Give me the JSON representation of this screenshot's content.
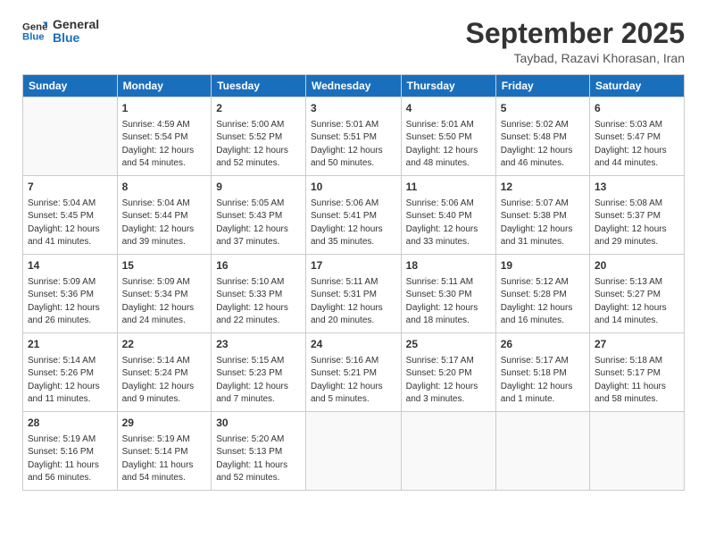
{
  "logo": {
    "line1": "General",
    "line2": "Blue"
  },
  "title": "September 2025",
  "location": "Taybad, Razavi Khorasan, Iran",
  "weekdays": [
    "Sunday",
    "Monday",
    "Tuesday",
    "Wednesday",
    "Thursday",
    "Friday",
    "Saturday"
  ],
  "weeks": [
    [
      {
        "day": "",
        "info": ""
      },
      {
        "day": "1",
        "info": "Sunrise: 4:59 AM\nSunset: 5:54 PM\nDaylight: 12 hours\nand 54 minutes."
      },
      {
        "day": "2",
        "info": "Sunrise: 5:00 AM\nSunset: 5:52 PM\nDaylight: 12 hours\nand 52 minutes."
      },
      {
        "day": "3",
        "info": "Sunrise: 5:01 AM\nSunset: 5:51 PM\nDaylight: 12 hours\nand 50 minutes."
      },
      {
        "day": "4",
        "info": "Sunrise: 5:01 AM\nSunset: 5:50 PM\nDaylight: 12 hours\nand 48 minutes."
      },
      {
        "day": "5",
        "info": "Sunrise: 5:02 AM\nSunset: 5:48 PM\nDaylight: 12 hours\nand 46 minutes."
      },
      {
        "day": "6",
        "info": "Sunrise: 5:03 AM\nSunset: 5:47 PM\nDaylight: 12 hours\nand 44 minutes."
      }
    ],
    [
      {
        "day": "7",
        "info": "Sunrise: 5:04 AM\nSunset: 5:45 PM\nDaylight: 12 hours\nand 41 minutes."
      },
      {
        "day": "8",
        "info": "Sunrise: 5:04 AM\nSunset: 5:44 PM\nDaylight: 12 hours\nand 39 minutes."
      },
      {
        "day": "9",
        "info": "Sunrise: 5:05 AM\nSunset: 5:43 PM\nDaylight: 12 hours\nand 37 minutes."
      },
      {
        "day": "10",
        "info": "Sunrise: 5:06 AM\nSunset: 5:41 PM\nDaylight: 12 hours\nand 35 minutes."
      },
      {
        "day": "11",
        "info": "Sunrise: 5:06 AM\nSunset: 5:40 PM\nDaylight: 12 hours\nand 33 minutes."
      },
      {
        "day": "12",
        "info": "Sunrise: 5:07 AM\nSunset: 5:38 PM\nDaylight: 12 hours\nand 31 minutes."
      },
      {
        "day": "13",
        "info": "Sunrise: 5:08 AM\nSunset: 5:37 PM\nDaylight: 12 hours\nand 29 minutes."
      }
    ],
    [
      {
        "day": "14",
        "info": "Sunrise: 5:09 AM\nSunset: 5:36 PM\nDaylight: 12 hours\nand 26 minutes."
      },
      {
        "day": "15",
        "info": "Sunrise: 5:09 AM\nSunset: 5:34 PM\nDaylight: 12 hours\nand 24 minutes."
      },
      {
        "day": "16",
        "info": "Sunrise: 5:10 AM\nSunset: 5:33 PM\nDaylight: 12 hours\nand 22 minutes."
      },
      {
        "day": "17",
        "info": "Sunrise: 5:11 AM\nSunset: 5:31 PM\nDaylight: 12 hours\nand 20 minutes."
      },
      {
        "day": "18",
        "info": "Sunrise: 5:11 AM\nSunset: 5:30 PM\nDaylight: 12 hours\nand 18 minutes."
      },
      {
        "day": "19",
        "info": "Sunrise: 5:12 AM\nSunset: 5:28 PM\nDaylight: 12 hours\nand 16 minutes."
      },
      {
        "day": "20",
        "info": "Sunrise: 5:13 AM\nSunset: 5:27 PM\nDaylight: 12 hours\nand 14 minutes."
      }
    ],
    [
      {
        "day": "21",
        "info": "Sunrise: 5:14 AM\nSunset: 5:26 PM\nDaylight: 12 hours\nand 11 minutes."
      },
      {
        "day": "22",
        "info": "Sunrise: 5:14 AM\nSunset: 5:24 PM\nDaylight: 12 hours\nand 9 minutes."
      },
      {
        "day": "23",
        "info": "Sunrise: 5:15 AM\nSunset: 5:23 PM\nDaylight: 12 hours\nand 7 minutes."
      },
      {
        "day": "24",
        "info": "Sunrise: 5:16 AM\nSunset: 5:21 PM\nDaylight: 12 hours\nand 5 minutes."
      },
      {
        "day": "25",
        "info": "Sunrise: 5:17 AM\nSunset: 5:20 PM\nDaylight: 12 hours\nand 3 minutes."
      },
      {
        "day": "26",
        "info": "Sunrise: 5:17 AM\nSunset: 5:18 PM\nDaylight: 12 hours\nand 1 minute."
      },
      {
        "day": "27",
        "info": "Sunrise: 5:18 AM\nSunset: 5:17 PM\nDaylight: 11 hours\nand 58 minutes."
      }
    ],
    [
      {
        "day": "28",
        "info": "Sunrise: 5:19 AM\nSunset: 5:16 PM\nDaylight: 11 hours\nand 56 minutes."
      },
      {
        "day": "29",
        "info": "Sunrise: 5:19 AM\nSunset: 5:14 PM\nDaylight: 11 hours\nand 54 minutes."
      },
      {
        "day": "30",
        "info": "Sunrise: 5:20 AM\nSunset: 5:13 PM\nDaylight: 11 hours\nand 52 minutes."
      },
      {
        "day": "",
        "info": ""
      },
      {
        "day": "",
        "info": ""
      },
      {
        "day": "",
        "info": ""
      },
      {
        "day": "",
        "info": ""
      }
    ]
  ]
}
